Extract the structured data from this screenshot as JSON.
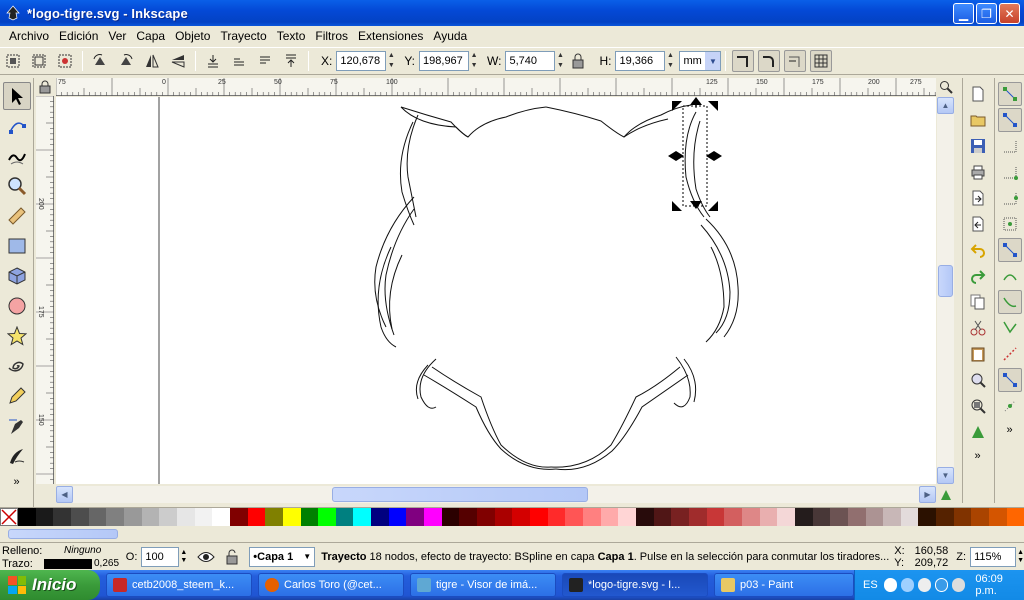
{
  "window": {
    "title": "*logo-tigre.svg - Inkscape"
  },
  "menu": [
    "Archivo",
    "Edición",
    "Ver",
    "Capa",
    "Objeto",
    "Trayecto",
    "Texto",
    "Filtros",
    "Extensiones",
    "Ayuda"
  ],
  "controls": {
    "x_label": "X:",
    "x_value": "120,678",
    "y_label": "Y:",
    "y_value": "198,967",
    "w_label": "W:",
    "w_value": "5,740",
    "h_label": "H:",
    "h_value": "19,366",
    "unit": "mm"
  },
  "rulers": {
    "h_ticks": [
      "75",
      "0",
      "25",
      "50",
      "75",
      "100",
      "125",
      "150",
      "175",
      "200",
      "225",
      "250",
      "275"
    ],
    "v_ticks": [
      "225",
      "200",
      "175",
      "150"
    ]
  },
  "palette": [
    "#000000",
    "#1a1a1a",
    "#333333",
    "#4d4d4d",
    "#666666",
    "#808080",
    "#999999",
    "#b3b3b3",
    "#cccccc",
    "#e6e6e6",
    "#f2f2f2",
    "#ffffff",
    "#800000",
    "#ff0000",
    "#808000",
    "#ffff00",
    "#008000",
    "#00ff00",
    "#008080",
    "#00ffff",
    "#000080",
    "#0000ff",
    "#800080",
    "#ff00ff",
    "#2b0000",
    "#550000",
    "#800000",
    "#aa0000",
    "#d40000",
    "#ff0000",
    "#ff2a2a",
    "#ff5555",
    "#ff8080",
    "#ffaaaa",
    "#ffd5d5",
    "#280b0b",
    "#501616",
    "#782121",
    "#a02c2c",
    "#c83737",
    "#d35f5f",
    "#de8787",
    "#e9afaf",
    "#f4d7d7",
    "#241c1c",
    "#483737",
    "#6c5353",
    "#916f6f",
    "#ac9393",
    "#c8b7b7",
    "#e3dbdb",
    "#2b1100",
    "#552200",
    "#803300",
    "#aa4400",
    "#d45500",
    "#ff6600"
  ],
  "status": {
    "fill_label": "Relleno:",
    "fill_value": "Ninguno",
    "stroke_label": "Trazo:",
    "stroke_width": "0,265",
    "opacity_label": "O:",
    "opacity_value": "100",
    "layer": "•Capa 1",
    "message_bold": "Trayecto",
    "message_mid": " 18 nodos, efecto de trayecto: BSpline en capa ",
    "message_layer": "Capa 1",
    "message_tail": ". Pulse en la selección para conmutar los tiradores...",
    "cx_label": "X:",
    "cx_value": "160,58",
    "cy_label": "Y:",
    "cy_value": "209,72",
    "zoom_label": "Z:",
    "zoom_value": "115%"
  },
  "taskbar": {
    "start": "Inicio",
    "tasks": [
      "cetb2008_steem_k...",
      "Carlos Toro (@cet...",
      "tigre - Visor de imá...",
      "*logo-tigre.svg - I...",
      "p03 - Paint"
    ],
    "lang": "ES",
    "time": "06:09 p.m."
  },
  "colors": {
    "accent_title": "#0449D6",
    "xp_green": "#3A9B3A",
    "handle": "#000000"
  }
}
